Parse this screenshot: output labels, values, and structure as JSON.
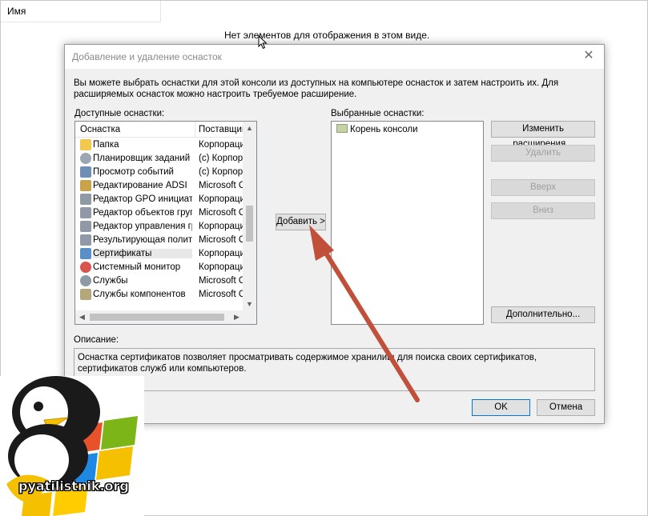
{
  "background": {
    "column_header": "Имя",
    "empty_message": "Нет элементов для отображения в этом виде."
  },
  "dialog": {
    "title": "Добавление и удаление оснасток",
    "intro": "Вы можете выбрать оснастки для этой консоли из доступных на компьютере оснасток и затем настроить их. Для расширяемых оснасток можно настроить требуемое расширение.",
    "available_label": "Доступные оснастки:",
    "selected_label": "Выбранные оснастки:",
    "columns": {
      "snapin": "Оснастка",
      "vendor": "Поставщик"
    },
    "available_items": [
      {
        "name": "Папка",
        "vendor": "Корпорация",
        "icon": "folder-icon"
      },
      {
        "name": "Планировщик заданий",
        "vendor": "(c) Корпор",
        "icon": "clock-icon"
      },
      {
        "name": "Просмотр событий",
        "vendor": "(c) Корпор",
        "icon": "event-viewer-icon"
      },
      {
        "name": "Редактирование ADSI",
        "vendor": "Microsoft C",
        "icon": "edit-icon"
      },
      {
        "name": "Редактор GPO инициатора",
        "vendor": "Корпорация",
        "icon": "policy-icon"
      },
      {
        "name": "Редактор объектов групповой",
        "vendor": "Microsoft C",
        "icon": "policy-icon"
      },
      {
        "name": "Редактор управления групп",
        "vendor": "Корпорация",
        "icon": "policy-icon"
      },
      {
        "name": "Результирующая политика",
        "vendor": "Microsoft C",
        "icon": "policy-icon"
      },
      {
        "name": "Сертификаты",
        "vendor": "Корпорация",
        "icon": "certificate-icon"
      },
      {
        "name": "Системный монитор",
        "vendor": "Корпорация",
        "icon": "monitor-icon"
      },
      {
        "name": "Службы",
        "vendor": "Microsoft C",
        "icon": "gear-icon"
      },
      {
        "name": "Службы компонентов",
        "vendor": "Microsoft C",
        "icon": "component-icon"
      }
    ],
    "selected_items": [
      {
        "name": "Корень консоли",
        "icon": "folder-icon"
      }
    ],
    "buttons": {
      "add": "Добавить >",
      "edit_extensions": "Изменить расширения...",
      "remove": "Удалить",
      "move_up": "Вверх",
      "move_down": "Вниз",
      "advanced": "Дополнительно...",
      "ok": "OK",
      "cancel": "Отмена"
    },
    "description_label": "Описание:",
    "description": "Оснастка сертификатов позволяет просматривать содержимое хранилищ для поиска своих сертификатов, сертификатов служб или компьютеров."
  },
  "watermark": {
    "site": "pyatilistnik.org"
  },
  "colors": {
    "arrow": "#c0503a",
    "accent": "#0078d7",
    "dialog_bg": "#f0f0f0"
  }
}
